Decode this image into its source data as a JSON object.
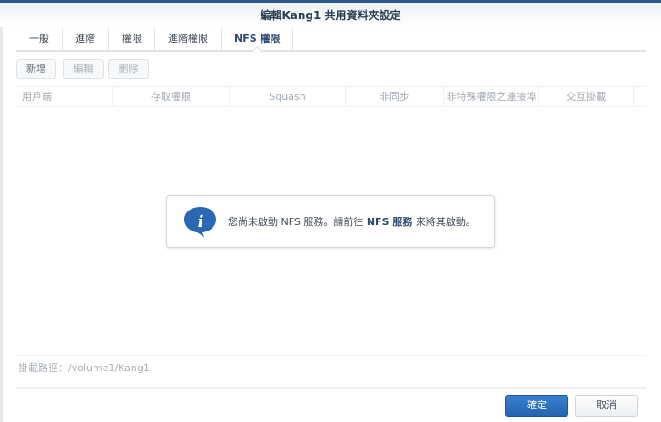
{
  "window": {
    "title": "編輯Kang1 共用資料夾設定"
  },
  "tabs": [
    {
      "label": "一般"
    },
    {
      "label": "進階"
    },
    {
      "label": "權限"
    },
    {
      "label": "進階權限"
    },
    {
      "label": "NFS 權限"
    }
  ],
  "toolbar": {
    "add": "新增",
    "edit": "編輯",
    "delete": "刪除"
  },
  "table": {
    "columns": [
      "用戶端",
      "存取權限",
      "Squash",
      "非同步",
      "非特殊權限之連接埠",
      "交互掛載"
    ]
  },
  "message": {
    "prefix": "您尚未啟動 NFS 服務。請前往 ",
    "link": "NFS 服務",
    "suffix": " 來將其啟動。"
  },
  "mount_path": "掛載路徑：/volume1/Kang1",
  "footer": {
    "ok": "確定",
    "cancel": "取消"
  }
}
